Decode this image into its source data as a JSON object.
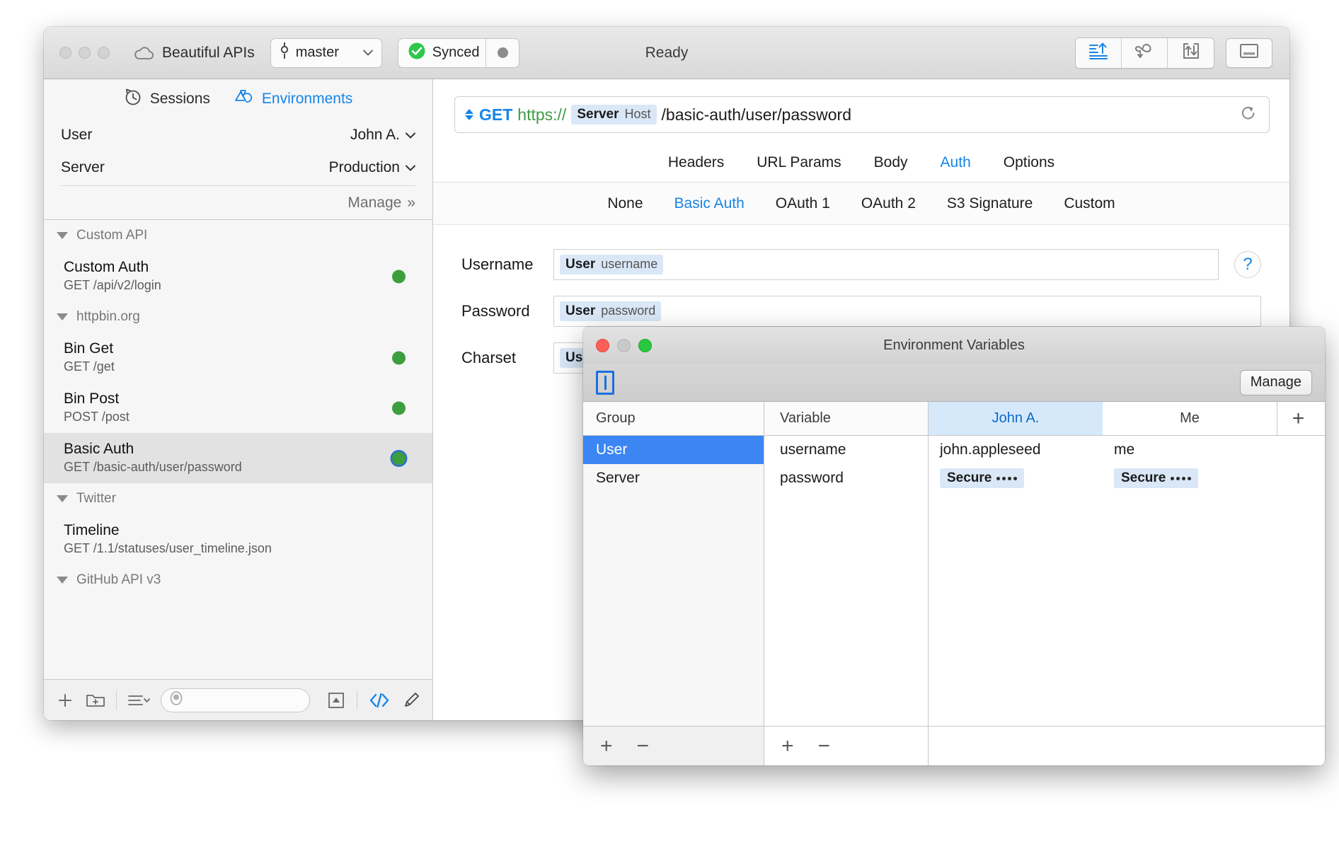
{
  "toolbar": {
    "app_name": "Beautiful APIs",
    "branch": "master",
    "sync_label": "Synced",
    "status": "Ready",
    "icons": {
      "cloud": "cloud-icon",
      "branch": "git-branch-icon",
      "sync_check": "check-circle-icon",
      "sync_dot": "activity-dot-icon",
      "send": "send-request-icon",
      "history": "loop-history-icon",
      "import": "import-export-icon",
      "panel": "toggle-panel-icon"
    }
  },
  "sidebar": {
    "tabs": [
      {
        "label": "Sessions",
        "icon": "history-clock-icon",
        "active": false
      },
      {
        "label": "Environments",
        "icon": "environments-icon",
        "active": true
      }
    ],
    "env_rows": [
      {
        "label": "User",
        "value": "John A."
      },
      {
        "label": "Server",
        "value": "Production"
      }
    ],
    "manage_label": "Manage",
    "manage_chevron": "»",
    "groups": [
      {
        "name": "Custom API",
        "requests": [
          {
            "name": "Custom Auth",
            "method": "GET",
            "path": "/api/v2/login",
            "status": "green",
            "selected": false
          }
        ]
      },
      {
        "name": "httpbin.org",
        "requests": [
          {
            "name": "Bin Get",
            "method": "GET",
            "path": "/get",
            "status": "green",
            "selected": false
          },
          {
            "name": "Bin Post",
            "method": "POST",
            "path": "/post",
            "status": "green",
            "selected": false
          },
          {
            "name": "Basic Auth",
            "method": "GET",
            "path": "/basic-auth/user/password",
            "status": "green",
            "selected": true
          }
        ]
      },
      {
        "name": "Twitter",
        "requests": [
          {
            "name": "Timeline",
            "method": "GET",
            "path": "/1.1/statuses/user_timeline.json",
            "status": "none",
            "selected": false
          }
        ]
      },
      {
        "name": "GitHub API v3",
        "requests": []
      }
    ],
    "footer": {
      "add_request": "add-request-icon",
      "add_folder": "new-folder-icon",
      "sort": "sort-list-icon",
      "search_placeholder": ""
    }
  },
  "main": {
    "url": {
      "method": "GET",
      "scheme": "https://",
      "token_group": "Server",
      "token_variable": "Host",
      "path": "/basic-auth/user/password",
      "reload_icon": "reload-icon"
    },
    "tabs": [
      {
        "label": "Headers",
        "active": false
      },
      {
        "label": "URL Params",
        "active": false
      },
      {
        "label": "Body",
        "active": false
      },
      {
        "label": "Auth",
        "active": true
      },
      {
        "label": "Options",
        "active": false
      }
    ],
    "subtabs": [
      {
        "label": "None",
        "active": false
      },
      {
        "label": "Basic Auth",
        "active": true
      },
      {
        "label": "OAuth 1",
        "active": false
      },
      {
        "label": "OAuth 2",
        "active": false
      },
      {
        "label": "S3 Signature",
        "active": false
      },
      {
        "label": "Custom",
        "active": false
      }
    ],
    "form": [
      {
        "label": "Username",
        "token_group": "User",
        "token_variable": "username",
        "has_help": true
      },
      {
        "label": "Password",
        "token_group": "User",
        "token_variable": "password",
        "has_help": false
      },
      {
        "label": "Charset",
        "token_group": "User",
        "token_variable": "",
        "has_help": false
      }
    ],
    "help_label": "?"
  },
  "dialog": {
    "title": "Environment Variables",
    "manage_label": "Manage",
    "columns": {
      "group": "Group",
      "variable": "Variable",
      "values": [
        {
          "label": "John A.",
          "selected": true
        },
        {
          "label": "Me",
          "selected": false
        }
      ],
      "add_column": "+"
    },
    "groups": [
      {
        "label": "User",
        "selected": true
      },
      {
        "label": "Server",
        "selected": false
      }
    ],
    "variables": [
      "username",
      "password"
    ],
    "rows": [
      {
        "variable": "username",
        "values": [
          {
            "text": "john.appleseed",
            "secure": false
          },
          {
            "text": "me",
            "secure": false
          }
        ]
      },
      {
        "variable": "password",
        "values": [
          {
            "text": "Secure",
            "secure": true
          },
          {
            "text": "Secure",
            "secure": true
          }
        ]
      }
    ],
    "footer": {
      "add": "+",
      "remove": "−"
    }
  },
  "colors": {
    "accent_blue": "#1585e8",
    "selection_blue": "#3b86f2",
    "token_bg": "#d9e7f7",
    "green_status": "#3d9e3d",
    "scheme_green": "#3e9a46"
  }
}
